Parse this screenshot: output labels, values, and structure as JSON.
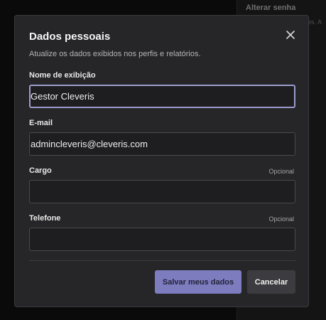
{
  "background": {
    "tab_label": "Alterar senha",
    "hint_text": "res. A"
  },
  "dialog": {
    "title": "Dados pessoais",
    "subtitle": "Atualize os dados exibidos nos perfis e relatórios.",
    "close_icon": "close-icon",
    "fields": {
      "display_name": {
        "label": "Nome de exibição",
        "value": "Gestor Cleveris"
      },
      "email": {
        "label": "E-mail",
        "value": "admincleveris@cleveris.com"
      },
      "role": {
        "label": "Cargo",
        "optional_label": "Opcional",
        "value": ""
      },
      "phone": {
        "label": "Telefone",
        "optional_label": "Opcional",
        "value": ""
      }
    },
    "buttons": {
      "save": "Salvar meus dados",
      "cancel": "Cancelar"
    }
  },
  "colors": {
    "accent": "#7c7cbf",
    "focus_border": "#9c9ccc",
    "dialog_bg": "#262628"
  }
}
